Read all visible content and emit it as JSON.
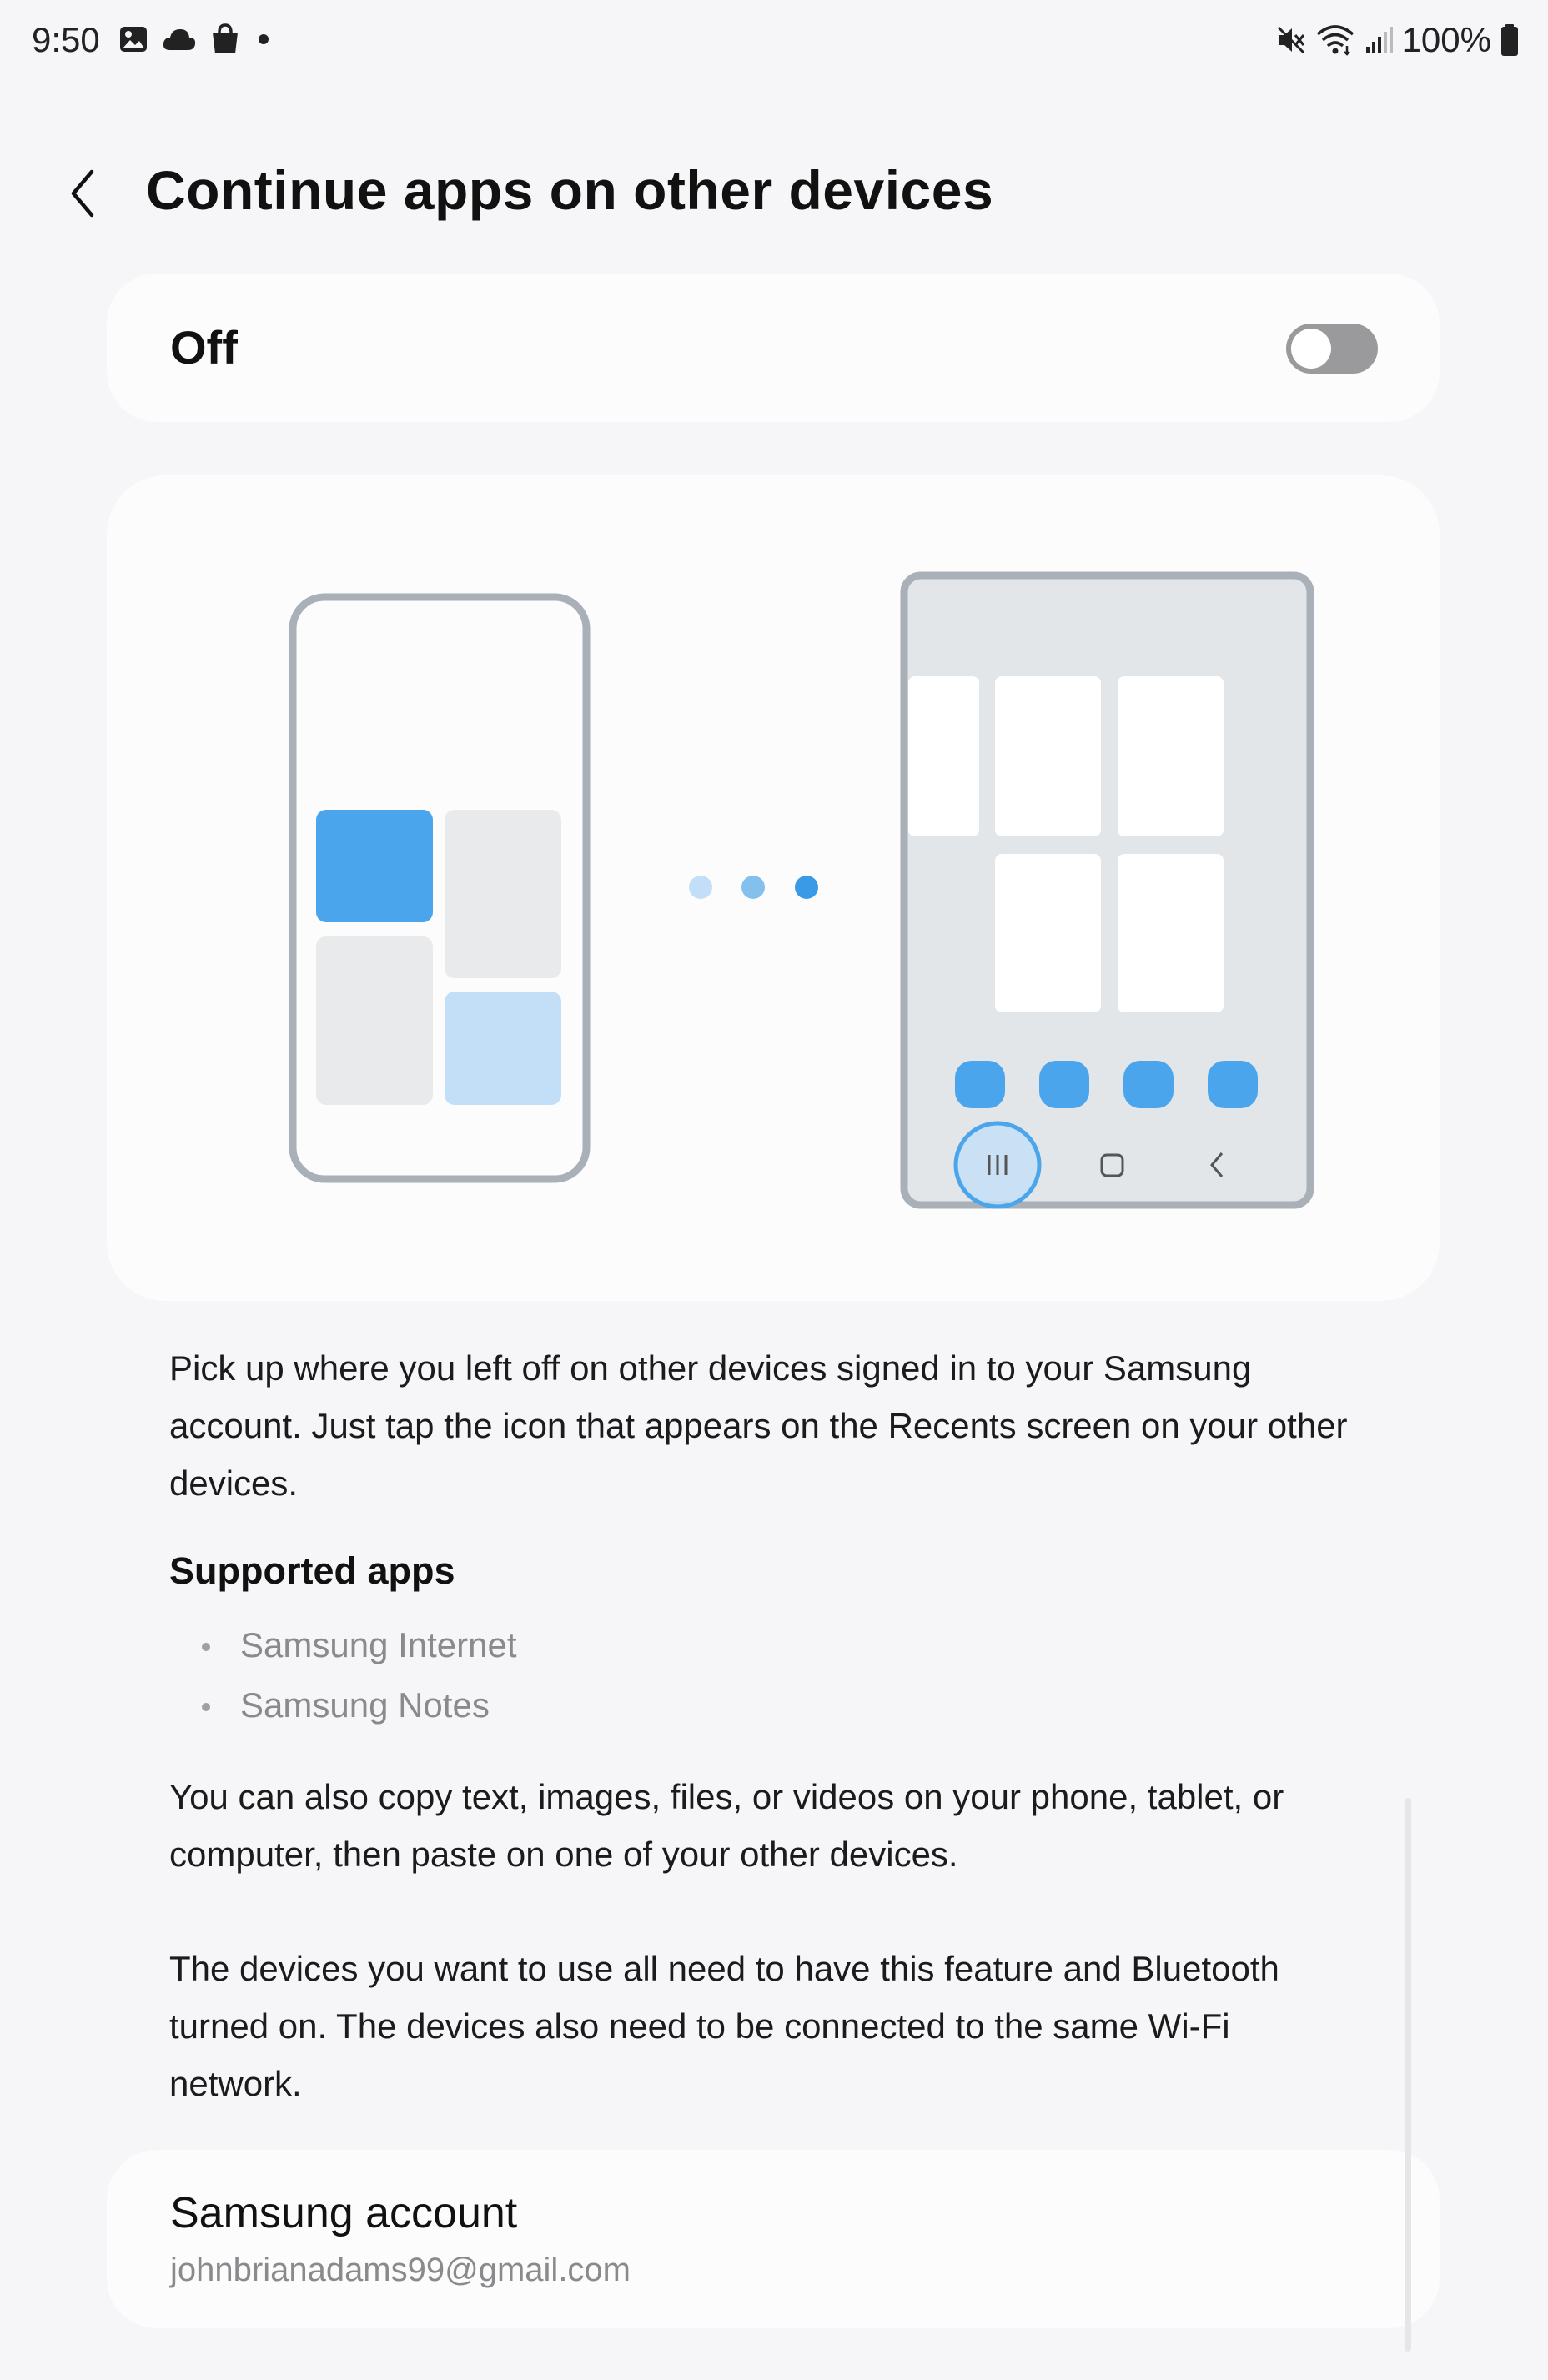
{
  "status_bar": {
    "time": "9:50",
    "left_icons": [
      "gallery-icon",
      "cloud-icon",
      "shopping-bag-icon",
      "dot-icon"
    ],
    "right_icons": [
      "mute-icon",
      "wifi-icon",
      "signal-icon",
      "battery-icon"
    ],
    "battery": "100%"
  },
  "header": {
    "title": "Continue apps on other devices"
  },
  "toggle": {
    "label": "Off",
    "state": "off"
  },
  "description": {
    "paragraph1": "Pick up where you left off on other devices signed in to your Samsung account. Just tap the icon that appears on the Recents screen on your other devices.",
    "supported_title": "Supported apps",
    "apps": [
      "Samsung Internet",
      "Samsung Notes"
    ],
    "paragraph2": "You can also copy text, images, files, or videos on your phone, tablet, or computer, then paste on one of your other devices.",
    "paragraph3": "The devices you want to use all need to have this feature and Bluetooth turned on. The devices also need to be connected to the same Wi-Fi network."
  },
  "account": {
    "title": "Samsung account",
    "email": "johnbrianadams99@gmail.com"
  },
  "colors": {
    "accent_blue": "#4aa5ec",
    "light_blue": "#c3dff7",
    "frame_gray": "#a9b0b7",
    "background": "#f6f6f8",
    "card": "#fcfcfd"
  }
}
